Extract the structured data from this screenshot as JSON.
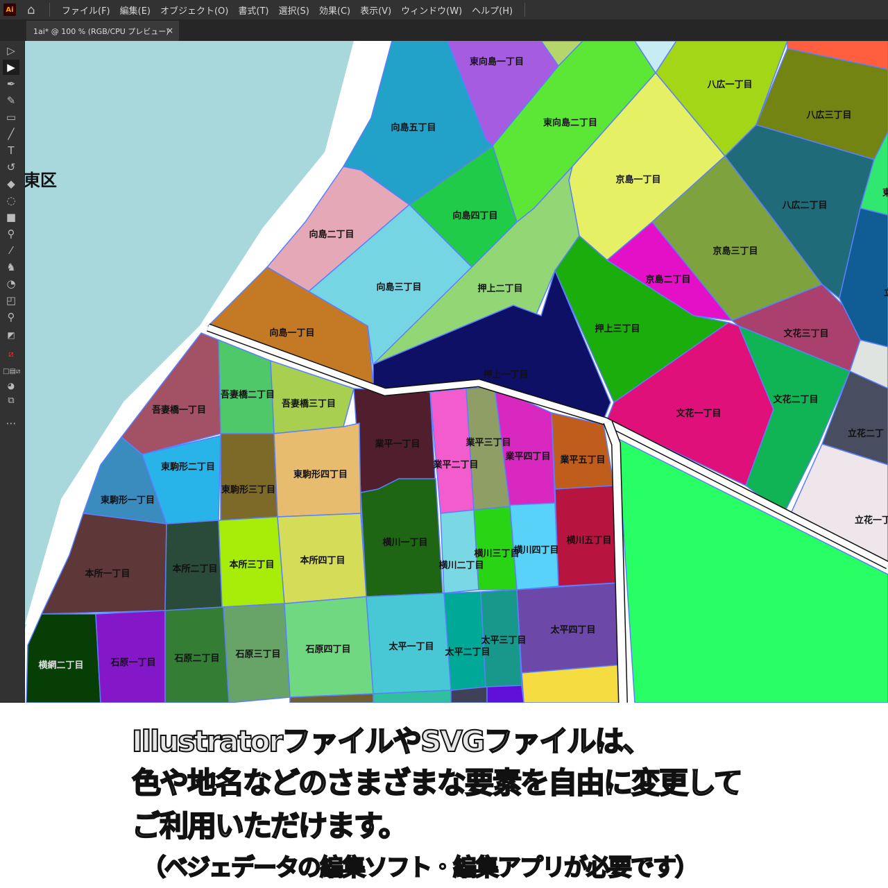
{
  "menubar": {
    "logo": "Ai",
    "items": [
      "ファイル(F)",
      "編集(E)",
      "オブジェクト(O)",
      "書式(T)",
      "選択(S)",
      "効果(C)",
      "表示(V)",
      "ウィンドウ(W)",
      "ヘルプ(H)"
    ]
  },
  "document_tab": {
    "title": "1ai* @ 100 % (RGB/CPU プレビュー)",
    "close": "×"
  },
  "toolbar": {
    "tools": [
      "selection",
      "direct-selection",
      "pen",
      "curvature",
      "rectangle",
      "paintbrush",
      "type",
      "rotate",
      "eraser",
      "lasso",
      "gradient",
      "eyedropper-measure",
      "eyedropper",
      "puppet-warp",
      "shape-builder",
      "artboard",
      "zoom"
    ]
  },
  "map": {
    "ward_label": "東区",
    "areas": {
      "mukoujima5": "向島五丁目",
      "higashimukoujima1": "東向島一丁目",
      "higashimukoujima2": "東向島二丁目",
      "yahiro1": "八広一丁目",
      "yahiro3": "八広三丁目",
      "yahiro2": "八広二丁目",
      "kyojima1": "京島一丁目",
      "kyojima3": "京島三丁目",
      "kyojima2": "京島二丁目",
      "mukoujima2": "向島二丁目",
      "mukoujima4": "向島四丁目",
      "mukoujima3": "向島三丁目",
      "oshiage2": "押上二丁目",
      "mukoujima1": "向島一丁目",
      "oshiage1": "押上一丁目",
      "oshiage3": "押上三丁目",
      "bunka3": "文花三丁目",
      "bunka1": "文花一丁目",
      "bunka2": "文花二丁目",
      "tachibana2": "立花二丁",
      "tachibana1": "立花一丁",
      "edge_higashi": "東",
      "edge_tachi": "立",
      "azumabashi1": "吾妻橋一丁目",
      "azumabashi2": "吾妻橋二丁目",
      "azumabashi3": "吾妻橋三丁目",
      "narihira1": "業平一丁目",
      "narihira2": "業平二丁目",
      "narihira3": "業平三丁目",
      "narihira4": "業平四丁目",
      "narihira5": "業平五丁目",
      "komagata1": "東駒形一丁目",
      "komagata2": "東駒形二丁目",
      "komagata3": "東駒形三丁目",
      "komagata4": "東駒形四丁目",
      "yokokawa1": "横川一丁目",
      "yokokawa2": "横川二丁目",
      "yokokawa3": "横川三丁目",
      "yokokawa4": "横川四丁目",
      "yokokawa5": "横川五丁目",
      "honjo1": "本所一丁目",
      "honjo2": "本所二丁目",
      "honjo3": "本所三丁目",
      "honjo4": "本所四丁目",
      "yokoami2": "横網二丁目",
      "ishiwara1": "石原一丁目",
      "ishiwara2": "石原二丁目",
      "ishiwara3": "石原三丁目",
      "ishiwara4": "石原四丁目",
      "taihei1": "太平一丁目",
      "taihei2": "太平二丁目",
      "taihei3": "太平三丁目",
      "taihei4": "太平四丁目"
    },
    "colors": {
      "water": "#a8d8dc",
      "anchor": "#5a7fff"
    }
  },
  "caption": {
    "line1": "IllustratorファイルやSVGファイルは、",
    "line2": "色や地名などのさまざまな要素を自由に変更して",
    "line3": "ご利用いただけます。",
    "line4": "（ベジェデータの編集ソフト・編集アプリが必要です）"
  }
}
